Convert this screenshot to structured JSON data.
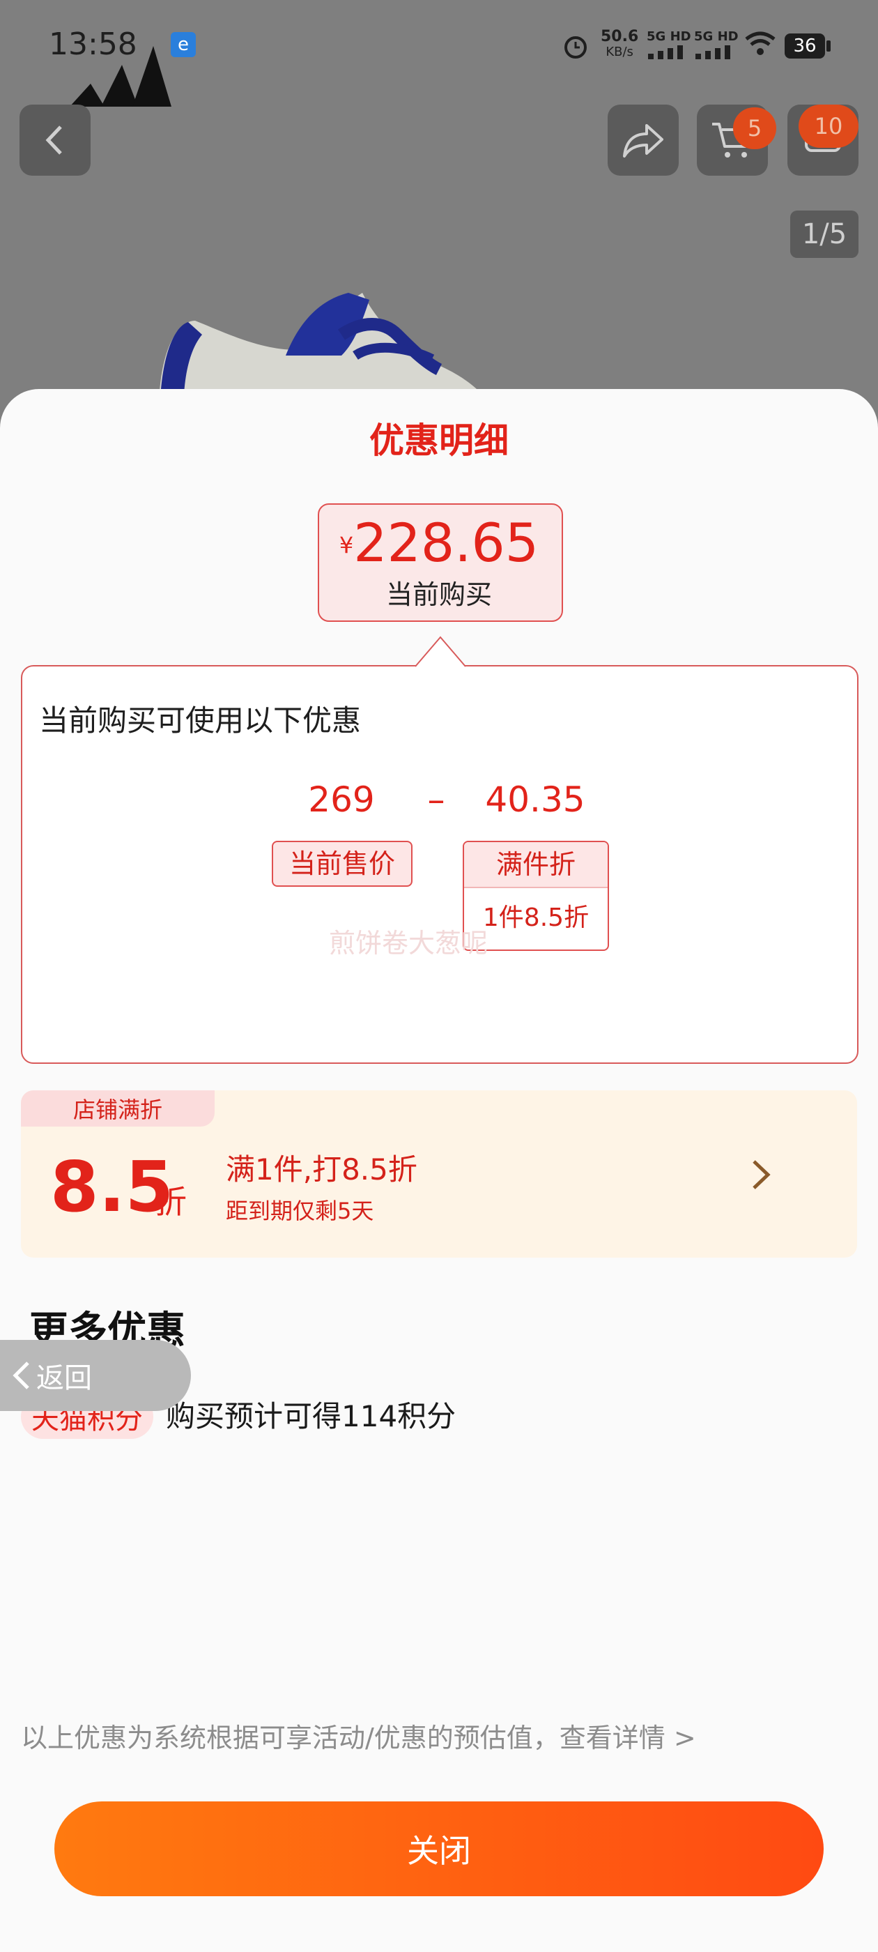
{
  "status_bar": {
    "time": "13:58",
    "net_speed_value": "50.6",
    "net_speed_unit": "KB/s",
    "signal1": "5G HD",
    "signal2": "5G HD",
    "battery": "36"
  },
  "header": {
    "cart_badge": "5",
    "message_badge": "10",
    "pager": "1/5"
  },
  "sheet": {
    "title": "优惠明细",
    "price_currency": "¥",
    "price_value": "228.65",
    "price_label": "当前购买",
    "box_title": "当前购买可使用以下优惠",
    "base_price": "269",
    "operator": "–",
    "discount_amount": "40.35",
    "base_tag": "当前售价",
    "discount_tag_title": "满件折",
    "discount_tag_detail": "1件8.5折",
    "watermark": "煎饼卷大葱呢"
  },
  "store_discount": {
    "tag": "店铺满折",
    "rate": "8.5",
    "unit": "折",
    "main_text": "满1件,打8.5折",
    "sub_text": "距到期仅剩5天"
  },
  "more": {
    "title": "更多优惠",
    "tmall_tag": "天猫积分",
    "tmall_text": "购买预计可得114积分"
  },
  "floating_back": {
    "label": "返回"
  },
  "footer": {
    "disclaimer": "以上优惠为系统根据可享活动/优惠的预估值，查看详情 >",
    "close_label": "关闭"
  },
  "colors": {
    "accent": "#e2231a",
    "button_start": "#ff7a10",
    "button_end": "#ff4a12"
  }
}
